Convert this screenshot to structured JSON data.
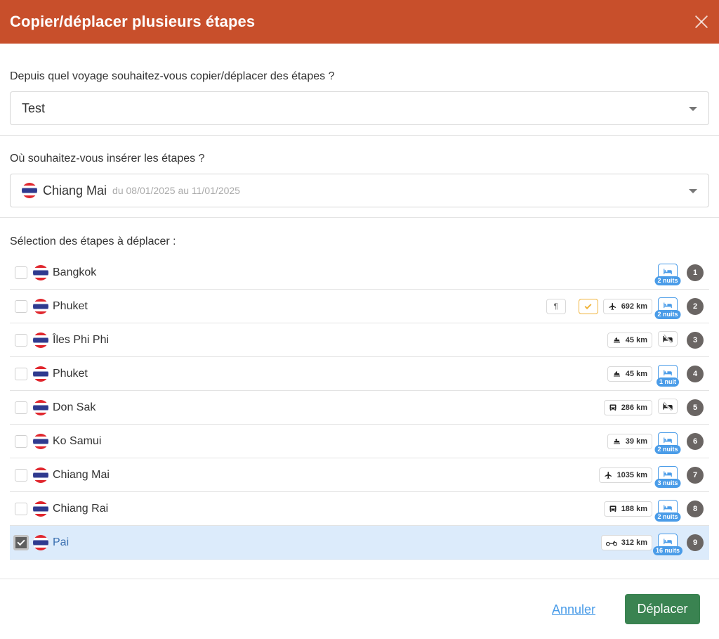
{
  "header": {
    "title": "Copier/déplacer plusieurs étapes"
  },
  "source": {
    "label": "Depuis quel voyage souhaitez-vous copier/déplacer des étapes ?",
    "value": "Test"
  },
  "destination": {
    "label": "Où souhaitez-vous insérer les étapes ?",
    "value": "Chiang Mai",
    "dates": "du 08/01/2025 au 11/01/2025"
  },
  "selection": {
    "label": "Sélection des étapes à déplacer :",
    "steps": [
      {
        "name": "Bangkok",
        "transport": null,
        "distance": null,
        "nights": "2 nuits",
        "num": "1",
        "checked": false
      },
      {
        "name": "Phuket",
        "transport": "plane",
        "distance": "692 km",
        "nights": "2 nuits",
        "num": "2",
        "checked": false,
        "extras": true
      },
      {
        "name": "Îles Phi Phi",
        "transport": "boat",
        "distance": "45 km",
        "nights": null,
        "num": "3",
        "checked": false
      },
      {
        "name": "Phuket",
        "transport": "boat",
        "distance": "45 km",
        "nights": "1 nuit",
        "num": "4",
        "checked": false
      },
      {
        "name": "Don Sak",
        "transport": "bus",
        "distance": "286 km",
        "nights": null,
        "num": "5",
        "checked": false
      },
      {
        "name": "Ko Samui",
        "transport": "boat",
        "distance": "39 km",
        "nights": "2 nuits",
        "num": "6",
        "checked": false
      },
      {
        "name": "Chiang Mai",
        "transport": "plane",
        "distance": "1035 km",
        "nights": "3 nuits",
        "num": "7",
        "checked": false
      },
      {
        "name": "Chiang Rai",
        "transport": "bus",
        "distance": "188 km",
        "nights": "2 nuits",
        "num": "8",
        "checked": false
      },
      {
        "name": "Pai",
        "transport": "moto",
        "distance": "312 km",
        "nights": "16 nuits",
        "num": "9",
        "checked": true
      }
    ],
    "paragraph_symbol": "¶"
  },
  "footer": {
    "cancel_label": "Annuler",
    "submit_label": "Déplacer"
  },
  "colors": {
    "header": "#c84f2b",
    "accent": "#4a9ce8",
    "submit": "#3a8351",
    "selected_row": "#dcebfb"
  }
}
